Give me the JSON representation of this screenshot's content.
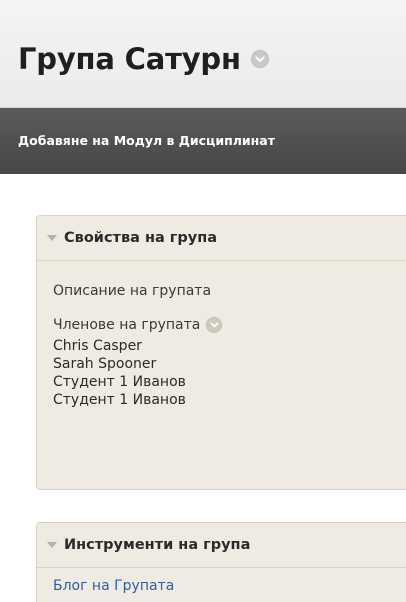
{
  "header": {
    "title": "Група Сатурн"
  },
  "actionbar": {
    "add_module_label": "Добавяне на Модул в Дисциплинат"
  },
  "properties_panel": {
    "title": "Свойства на група",
    "description_label": "Описание на групата",
    "members_label": "Членове на групата",
    "members": [
      "Chris Casper",
      "Sarah Spooner",
      "Студент 1 Иванов",
      "Студент 1 Иванов"
    ]
  },
  "tools_panel": {
    "title": "Инструменти на група",
    "items": [
      "Блог на Групата"
    ]
  },
  "colors": {
    "actionbar_bg": "#4f4f4f",
    "panel_bg": "#efebe3",
    "link": "#2a5f9e"
  }
}
